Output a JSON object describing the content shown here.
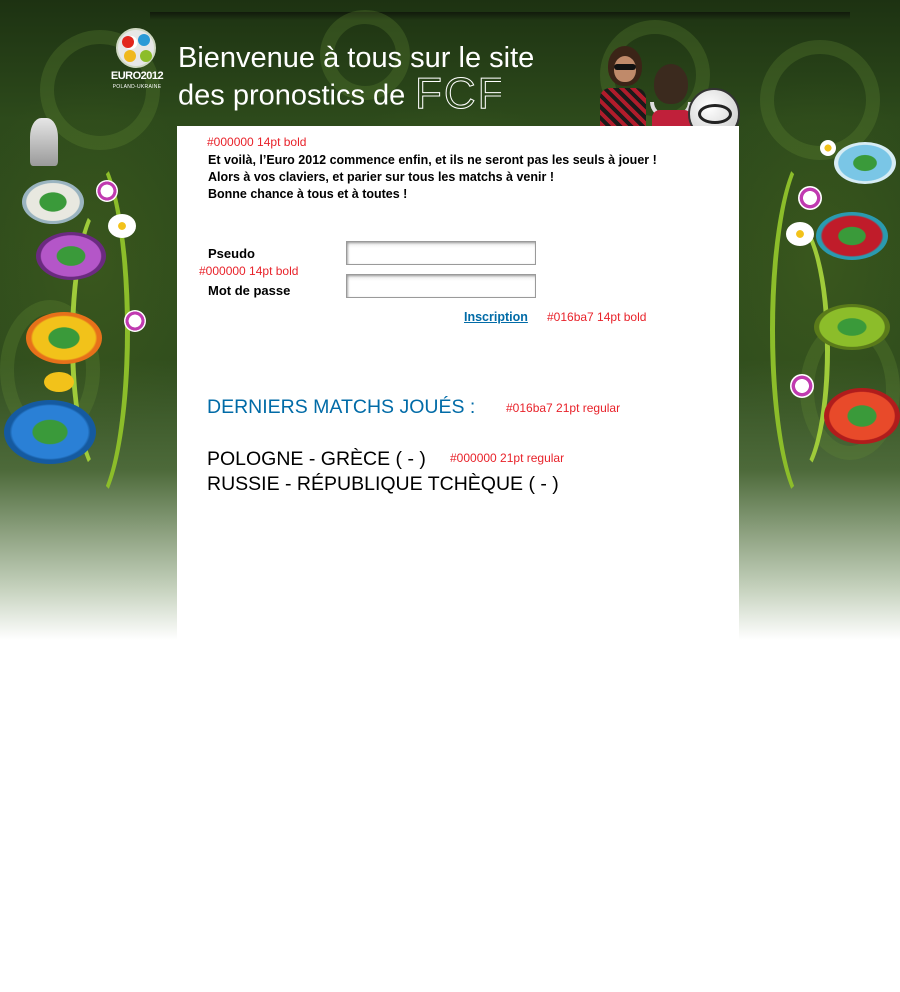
{
  "header": {
    "logo": {
      "brand": "EURO2012",
      "sub": "POLAND-UKRAINE"
    },
    "welcome_line1": "Bienvenue à tous sur le site",
    "welcome_line2": "des pronostics de",
    "fcf_text": "FCF"
  },
  "intro": {
    "annotation": "#000000 14pt bold",
    "lines": [
      "Et voilà, l’Euro 2012 commence enfin, et ils ne seront pas les seuls à jouer !",
      "Alors à vos claviers, et parier sur tous les matchs à venir !",
      "Bonne chance à tous et à toutes !"
    ]
  },
  "login": {
    "pseudo_label": "Pseudo",
    "annotation": "#000000 14pt bold",
    "password_label": "Mot de passe",
    "pseudo_value": "",
    "password_value": "",
    "inscription_label": "Inscription",
    "inscription_annotation": "#016ba7 14pt bold"
  },
  "matches": {
    "title": "DERNIERS MATCHS JOUÉS :",
    "title_annotation": "#016ba7 21pt regular",
    "items": [
      "POLOGNE - GRÈCE ( - )",
      "RUSSIE - RÉPUBLIQUE TCHÈQUE ( - )"
    ],
    "item_annotation": "#000000 21pt regular"
  },
  "colors": {
    "accent": "#016ba7",
    "annotation": "#e8222a",
    "background_dark": "#2d4a1b"
  }
}
